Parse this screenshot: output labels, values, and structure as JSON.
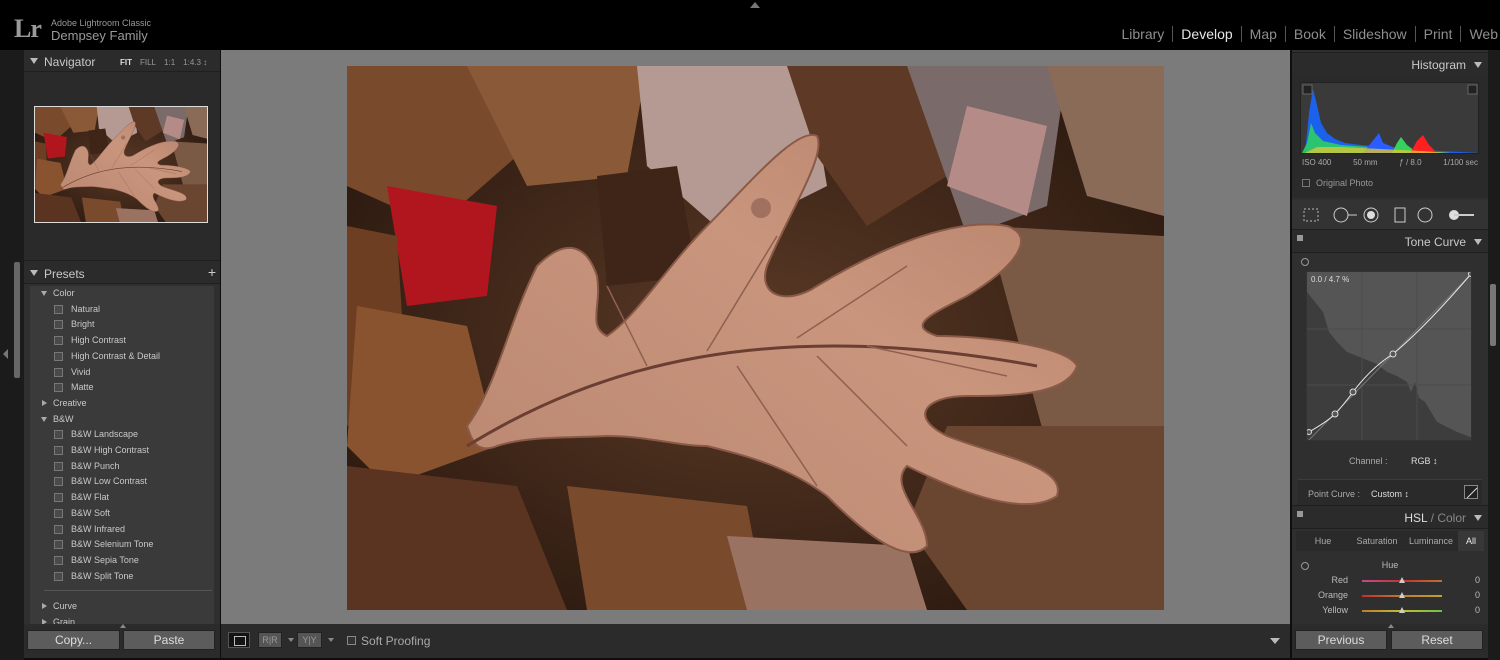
{
  "app": {
    "logo": "Lr",
    "product": "Adobe Lightroom Classic",
    "catalog": "Dempsey Family"
  },
  "modules": [
    "Library",
    "Develop",
    "Map",
    "Book",
    "Slideshow",
    "Print",
    "Web"
  ],
  "active_module": "Develop",
  "navigator": {
    "title": "Navigator",
    "zoom": [
      "FIT",
      "FILL",
      "1:1",
      "1:4.3 ↕"
    ]
  },
  "presets": {
    "title": "Presets",
    "add": "+",
    "groups": [
      {
        "label": "Color",
        "open": true,
        "items": [
          "Natural",
          "Bright",
          "High Contrast",
          "High Contrast & Detail",
          "Vivid",
          "Matte"
        ]
      },
      {
        "label": "Creative",
        "open": false,
        "items": []
      },
      {
        "label": "B&W",
        "open": true,
        "items": [
          "B&W Landscape",
          "B&W High Contrast",
          "B&W Punch",
          "B&W Low Contrast",
          "B&W Flat",
          "B&W Soft",
          "B&W Infrared",
          "B&W Selenium Tone",
          "B&W Sepia Tone",
          "B&W Split Tone"
        ]
      },
      {
        "label": "Curve",
        "open": false,
        "items": []
      },
      {
        "label": "Grain",
        "open": false,
        "items": []
      }
    ]
  },
  "left_buttons": {
    "copy": "Copy...",
    "paste": "Paste"
  },
  "toolbar": {
    "ba1": "R|R",
    "ba2": "Y|Y",
    "soft_proofing": "Soft Proofing"
  },
  "histogram": {
    "title": "Histogram",
    "iso": "ISO 400",
    "focal": "50 mm",
    "aperture": "ƒ / 8.0",
    "shutter": "1/100 sec",
    "original_photo": "Original Photo"
  },
  "tone_curve": {
    "title": "Tone Curve",
    "readout": "0.0 / 4.7 %",
    "channel_label": "Channel :",
    "channel_value": "RGB ↕",
    "point_curve_label": "Point Curve :",
    "point_curve_value": "Custom ↕"
  },
  "hsl": {
    "title": "HSL",
    "title_sep": " / ",
    "title_alt": "Color",
    "tabs": [
      "Hue",
      "Saturation",
      "Luminance",
      "All"
    ],
    "active_tab": "All",
    "section": "Hue",
    "rows": [
      {
        "label": "Red",
        "value": "0",
        "position": 0.5
      },
      {
        "label": "Orange",
        "value": "0",
        "position": 0.5
      },
      {
        "label": "Yellow",
        "value": "0",
        "position": 0.5
      }
    ]
  },
  "right_buttons": {
    "previous": "Previous",
    "reset": "Reset"
  },
  "colors": {
    "accent_active": "#e6e6e6",
    "panel_bg": "#2f2f2f",
    "canvas_bg": "#7b7b7b"
  }
}
